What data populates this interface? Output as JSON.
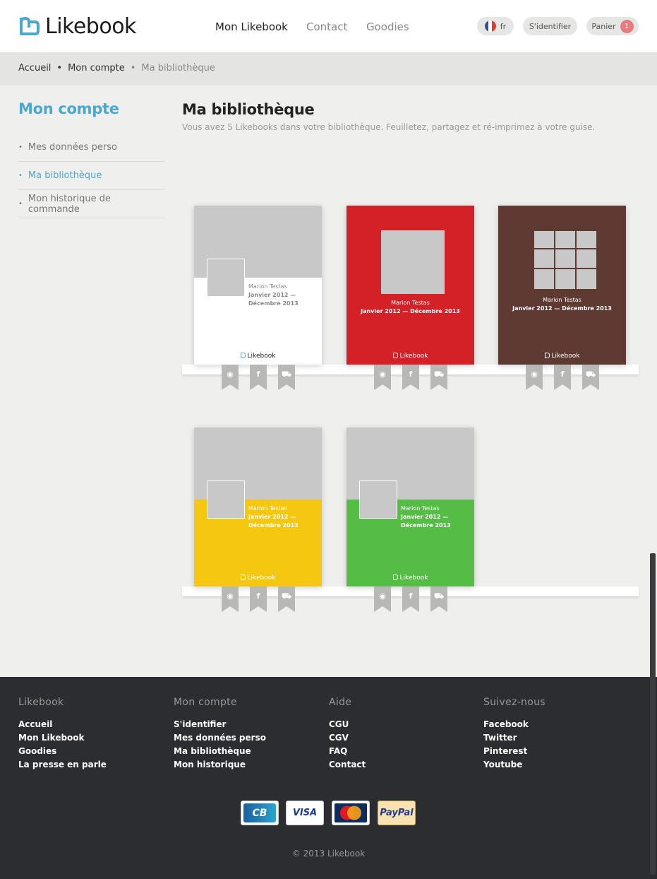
{
  "header": {
    "brand": "Likebook",
    "nav": [
      "Mon Likebook",
      "Contact",
      "Goodies"
    ],
    "lang": "fr",
    "login": "S'identifier",
    "cart": "Panier",
    "cart_count": "1",
    "accent_color": "#4aa8cf"
  },
  "breadcrumb": [
    "Accueil",
    "Mon compte",
    "Ma bibliothèque"
  ],
  "sidebar": {
    "title": "Mon compte",
    "items": [
      "Mes données perso",
      "Ma bibliothèque",
      "Mon historique de commande"
    ],
    "active_index": 1
  },
  "main": {
    "title": "Ma bibliothèque",
    "subtitle": "Vous avez 5 Likebooks dans votre bibliothèque. Feuilletez, partagez et ré-imprimez à votre guise.",
    "books": [
      {
        "color": "#ffffff",
        "text_color": "#888888",
        "layout": "split",
        "name": "Marion Testas",
        "date_line1": "Janvier 2012 —",
        "date_line2": "Décembre 2013",
        "brand": "Likebook"
      },
      {
        "color": "#d42027",
        "text_color": "#ffffff",
        "layout": "center",
        "name": "Marion Testas",
        "date_line1": "Janvier 2012 — Décembre 2013",
        "date_line2": "",
        "brand": "Likebook"
      },
      {
        "color": "#5e3a33",
        "text_color": "#ffffff",
        "layout": "mosaic",
        "name": "Marion Testas",
        "date_line1": "Janvier 2012 — Décembre 2013",
        "date_line2": "",
        "brand": "Likebook"
      },
      {
        "color": "#f6c710",
        "text_color": "#ffffff",
        "layout": "split",
        "name": "Marion Testas",
        "date_line1": "Janvier 2012 —",
        "date_line2": "Décembre 2013",
        "brand": "Likebook"
      },
      {
        "color": "#55bd45",
        "text_color": "#ffffff",
        "layout": "split",
        "name": "Marion Testas",
        "date_line1": "Janvier 2012 —",
        "date_line2": "Décembre 2013",
        "brand": "Likebook"
      }
    ],
    "actions": [
      "eye-icon",
      "facebook-icon",
      "cart-icon"
    ]
  },
  "footer": {
    "columns": [
      {
        "title": "Likebook",
        "links": [
          "Accueil",
          "Mon Likebook",
          "Goodies",
          "La presse en parle"
        ]
      },
      {
        "title": "Mon compte",
        "links": [
          "S'identifier",
          "Mes données perso",
          "Ma bibliothèque",
          "Mon historique"
        ]
      },
      {
        "title": "Aide",
        "links": [
          "CGU",
          "CGV",
          "FAQ",
          "Contact"
        ]
      },
      {
        "title": "Suivez-nous",
        "links": [
          "Facebook",
          "Twitter",
          "Pinterest",
          "Youtube"
        ]
      }
    ],
    "payments": [
      "CB",
      "VISA",
      "MasterCard",
      "PayPal"
    ],
    "copyright": "© 2013 Likebook"
  }
}
